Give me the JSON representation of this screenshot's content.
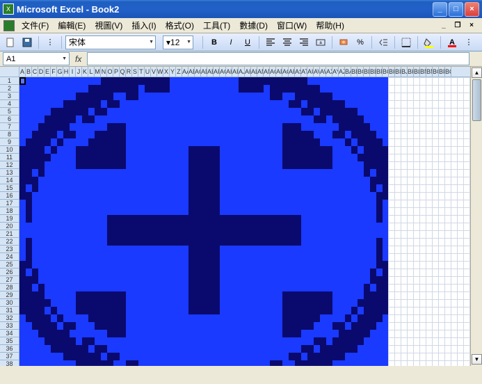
{
  "window": {
    "title": "Microsoft Excel - Book2"
  },
  "menu": {
    "file": "文件(F)",
    "edit": "編輯(E)",
    "view": "視圖(V)",
    "insert": "插入(I)",
    "format": "格式(O)",
    "tools": "工具(T)",
    "data": "數據(D)",
    "window": "窗口(W)",
    "help": "帮助(H)"
  },
  "toolbar": {
    "font_name": "宋体",
    "font_size": "12"
  },
  "formula": {
    "cell_ref": "A1",
    "fx": "fx",
    "value": ""
  },
  "grid": {
    "columns": [
      "A",
      "B",
      "C",
      "D",
      "E",
      "F",
      "G",
      "H",
      "I",
      "J",
      "K",
      "L",
      "M",
      "N",
      "O",
      "P",
      "Q",
      "R",
      "S",
      "T",
      "U",
      "V",
      "W",
      "X",
      "Y",
      "Z",
      "AA",
      "AB",
      "AC",
      "AD",
      "AE",
      "AF",
      "AG",
      "AH",
      "AI",
      "AJ",
      "AK",
      "AL",
      "AM",
      "AN",
      "AO",
      "AP",
      "AQ",
      "AR",
      "AS",
      "AT",
      "AU",
      "AV",
      "AW",
      "AX",
      "AY",
      "AZ",
      "BA",
      "BB",
      "BC",
      "BD",
      "BE",
      "BF",
      "BG",
      "BH",
      "BI",
      "BJ",
      "BK",
      "BL",
      "BM",
      "BN",
      "BO",
      "BP",
      "BQ"
    ],
    "row_count": 40,
    "colors": {
      "dark": "#0a0a6e",
      "bright": "#1a3aff"
    },
    "pattern_cols": 59,
    "active_cell": "A1"
  }
}
